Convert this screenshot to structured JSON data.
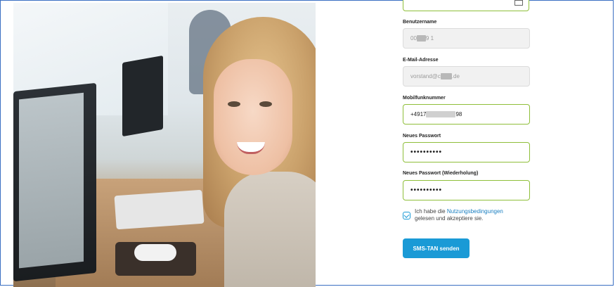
{
  "form": {
    "username": {
      "label": "Benutzername",
      "value_prefix": "00",
      "value_suffix": "9 1"
    },
    "email": {
      "label": "E-Mail-Adresse",
      "value_prefix": "vorstand@c",
      "value_suffix": ".de"
    },
    "mobile": {
      "label": "Mobilfunknummer",
      "value_prefix": "+4917",
      "value_suffix": "98"
    },
    "new_password": {
      "label": "Neues Passwort",
      "value": "••••••••••"
    },
    "new_password_repeat": {
      "label": "Neues Passwort (Wiederholung)",
      "value": "••••••••••"
    },
    "terms": {
      "text_before": "Ich habe die ",
      "link": "Nutzungsbedingungen",
      "text_after": "gelesen und akzeptiere sie.",
      "checked": true
    },
    "submit_label": "SMS-TAN senden"
  },
  "colors": {
    "accent": "#1a9ad6",
    "valid_border": "#8fbf3a",
    "frame_border": "#3a6fc2"
  }
}
